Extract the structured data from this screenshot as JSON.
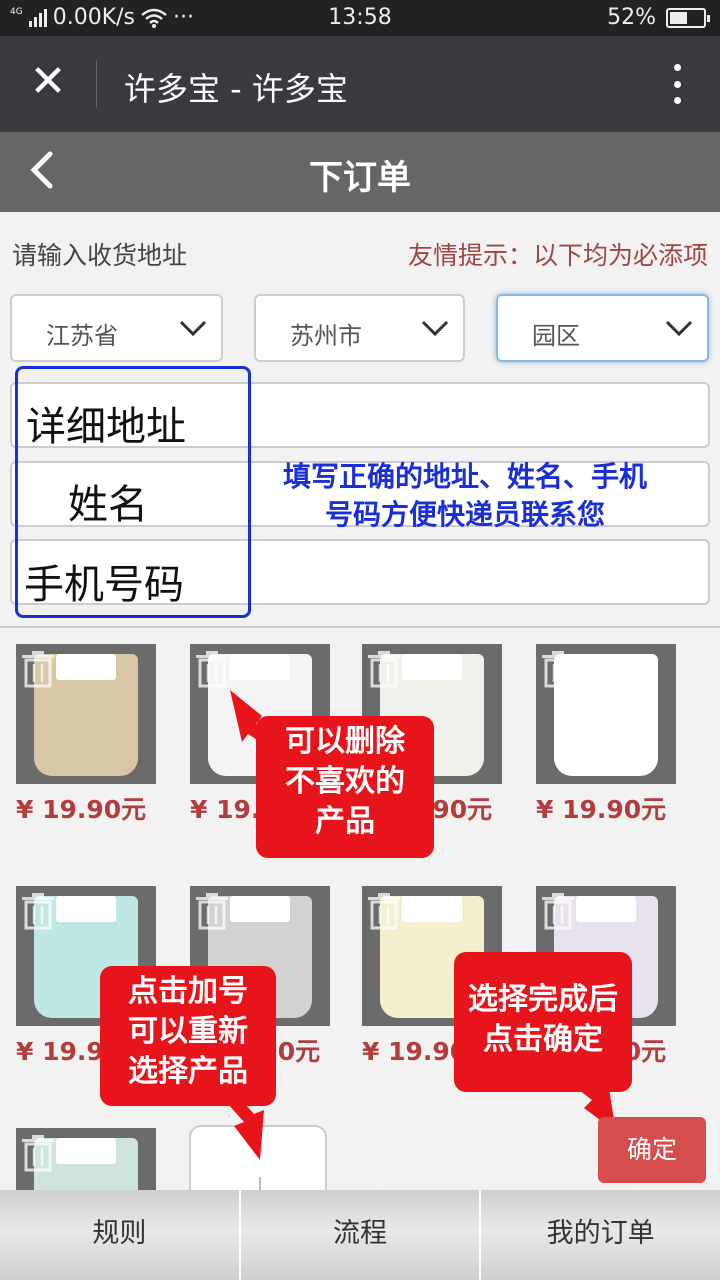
{
  "status_bar": {
    "network": "4G",
    "speed": "0.00K/s",
    "more": "···",
    "time": "13:58",
    "battery": "52%",
    "battery_level": 0.52
  },
  "wx_header": {
    "title": "许多宝 - 许多宝"
  },
  "page": {
    "title": "下订单"
  },
  "address": {
    "label": "请输入收货地址",
    "tip": "友情提示：以下均为必添项",
    "province": "江苏省",
    "city": "苏州市",
    "district": "园区"
  },
  "annotations": {
    "detail_address": "详细地址",
    "name": "姓名",
    "phone": "手机号码",
    "hint_line1": "填写正确的地址、姓名、手机",
    "hint_line2": "号码方便快递员联系您",
    "callout_delete": [
      "可以删除",
      "不喜欢的",
      "产品"
    ],
    "callout_add": [
      "点击加号",
      "可以重新",
      "选择产品"
    ],
    "callout_confirm": [
      "选择完成后",
      "点击确定"
    ]
  },
  "products": [
    {
      "price": "¥ 19.90元",
      "color": "#d8c8a8"
    },
    {
      "price": "¥ 19.90元",
      "color": "#f4f4f4"
    },
    {
      "price": "¥ 19.90元",
      "color": "#eef2ea"
    },
    {
      "price": "¥ 19.90元",
      "color": "#ffffff"
    },
    {
      "price": "¥ 19.90元",
      "color": "#bfe8e4"
    },
    {
      "price": "¥ 19.90元",
      "color": "#d2d2d2"
    },
    {
      "price": "¥ 19.90元",
      "color": "#f4efcf"
    },
    {
      "price": "¥ 19.90元",
      "color": "#e7e2ee"
    },
    {
      "price": "",
      "color": "#cfe4dc"
    }
  ],
  "confirm_label": "确定",
  "nav": {
    "rules": "规则",
    "process": "流程",
    "my_orders": "我的订单"
  },
  "colors": {
    "accent_red": "#e8141b",
    "price_red": "#b33c3c",
    "annot_blue": "#1a2fd6"
  }
}
